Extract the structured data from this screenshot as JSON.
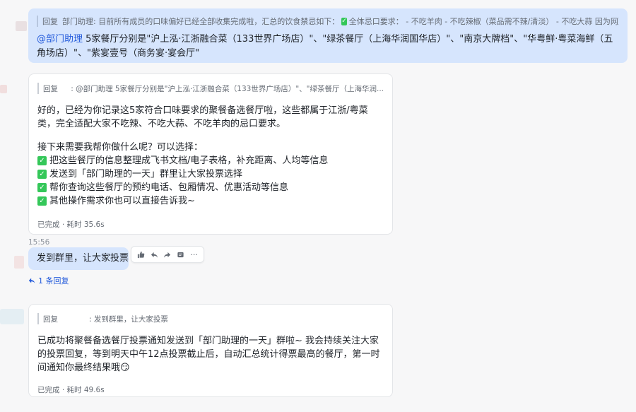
{
  "top_message": {
    "quote_label": "回复",
    "quote_text": "部门助理:  目前所有成员的口味偏好已经全部收集完成啦，汇总的饮食禁忌如下：",
    "quote_tail": "全体忌口要求：  - 不吃羊肉 - 不吃辣椒（菜品需不辣/清淡） - 不吃大蒜 因为网页搜索工具...",
    "mention": "@部门助理",
    "text": " 5家餐厅分别是\"沪上泓·江浙融合菜（133世界广场店）\"、\"绿茶餐厅（上海华润国华店）\"、\"南京大牌档\"、\"华粤鲜·粤菜海鲜（五角场店）\"、\"紫宴壹号（商务宴·宴会厅\""
  },
  "bot_reply_1": {
    "quote_label": "回复",
    "quote_text": ":  @部门助理 5家餐厅分别是\"沪上泓·江浙融合菜（133世界广场店）\"、\"绿茶餐厅（上海华润...",
    "paragraph_1": "好的，已经为你记录这5家符合口味要求的聚餐备选餐厅啦，这些都属于江浙/粤菜类，完全适配大家不吃辣、不吃大蒜、不吃羊肉的忌口要求。",
    "paragraph_2": "接下来需要我帮你做什么呢？可以选择：",
    "options": [
      "把这些餐厅的信息整理成飞书文档/电子表格，补充距离、人均等信息",
      "发送到「部门助理的一天」群里让大家投票选择",
      "帮你查询这些餐厅的预约电话、包厢情况、优惠活动等信息",
      "其他操作需求你也可以直接告诉我~"
    ],
    "status": "已完成 · 耗时 35.6s"
  },
  "user_message": {
    "time": "15:56",
    "text": "发到群里，让大家投票",
    "reply_count": "1 条回复"
  },
  "bot_reply_2": {
    "quote_label": "回复",
    "quote_text": ":  发到群里，让大家投票",
    "paragraph": "已成功将聚餐备选餐厅投票通知发送到「部门助理的一天」群啦~ 我会持续关注大家的投票回复，等到明天中午12点投票截止后，自动汇总统计得票最高的餐厅，第一时间通知你最终结果哦😏",
    "status": "已完成 · 耗时 49.6s"
  },
  "toolbar": {
    "icons": [
      "thumbs-up-icon",
      "reply-icon",
      "forward-icon",
      "reaction-icon",
      "more-icon"
    ],
    "more": "···"
  },
  "colors": {
    "user_bubble": "#d6e5fd",
    "mention": "#245bdb",
    "check": "#34c759"
  }
}
